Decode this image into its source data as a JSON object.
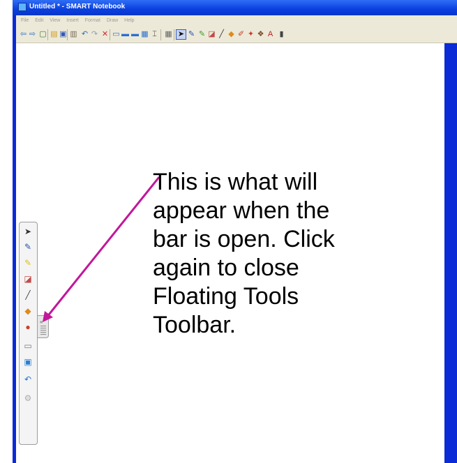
{
  "window": {
    "title": "Untitled * - SMART Notebook"
  },
  "menu": [
    "File",
    "Edit",
    "View",
    "Insert",
    "Format",
    "Draw",
    "Help"
  ],
  "toolbar": {
    "icons": [
      {
        "name": "back-icon",
        "glyph": "⇦",
        "color": "#2a6fd1"
      },
      {
        "name": "forward-icon",
        "glyph": "⇨",
        "color": "#2a6fd1"
      },
      {
        "name": "add-page-icon",
        "glyph": "▢",
        "color": "#3c7a2e"
      },
      {
        "name": "open-icon",
        "glyph": "▤",
        "color": "#d39a1a"
      },
      {
        "name": "save-icon",
        "glyph": "▣",
        "color": "#3059b8"
      },
      {
        "name": "paste-icon",
        "glyph": "▥",
        "color": "#7a6a5a"
      },
      {
        "name": "undo-icon",
        "glyph": "↶",
        "color": "#2a6fd1"
      },
      {
        "name": "redo-icon",
        "glyph": "↷",
        "color": "#8aa0c0"
      },
      {
        "name": "delete-icon",
        "glyph": "✕",
        "color": "#d12a2a"
      },
      {
        "name": "screen-shade-icon",
        "glyph": "▭",
        "color": "#2a6fd1"
      },
      {
        "name": "full-screen-icon",
        "glyph": "▬",
        "color": "#2a6fd1"
      },
      {
        "name": "dual-page-icon",
        "glyph": "▬",
        "color": "#2a6fd1"
      },
      {
        "name": "screen-capture-icon",
        "glyph": "▦",
        "color": "#2a6fd1"
      },
      {
        "name": "document-camera-icon",
        "glyph": "⌶",
        "color": "#333333"
      },
      {
        "name": "table-icon",
        "glyph": "▦",
        "color": "#666666"
      },
      {
        "name": "select-icon",
        "glyph": "➤",
        "color": "#111111"
      },
      {
        "name": "pen-icon",
        "glyph": "✎",
        "color": "#2a4fb0"
      },
      {
        "name": "creative-pen-icon",
        "glyph": "✎",
        "color": "#3d9a2a"
      },
      {
        "name": "eraser-icon",
        "glyph": "◪",
        "color": "#c14a4a"
      },
      {
        "name": "line-icon",
        "glyph": "╱",
        "color": "#333333"
      },
      {
        "name": "shapes-icon",
        "glyph": "◆",
        "color": "#e08a1a"
      },
      {
        "name": "fill-icon",
        "glyph": "✐",
        "color": "#c8402a"
      },
      {
        "name": "magic-pen-icon",
        "glyph": "✦",
        "color": "#c8402a"
      },
      {
        "name": "properties-icon",
        "glyph": "❖",
        "color": "#7a4a2a"
      },
      {
        "name": "text-icon",
        "glyph": "A",
        "color": "#c81a1a"
      },
      {
        "name": "more-icon",
        "glyph": "▮",
        "color": "#444444"
      }
    ]
  },
  "floating_toolbar": {
    "icons": [
      {
        "name": "select-icon",
        "glyph": "➤",
        "color": "#333333"
      },
      {
        "name": "pen-icon",
        "glyph": "✎",
        "color": "#2a4fb0"
      },
      {
        "name": "highlighter-icon",
        "glyph": "✎",
        "color": "#e0c21a"
      },
      {
        "name": "eraser-icon",
        "glyph": "◪",
        "color": "#c14a4a"
      },
      {
        "name": "line-icon",
        "glyph": "╱",
        "color": "#444444"
      },
      {
        "name": "shapes-icon",
        "glyph": "◆",
        "color": "#e08a1a"
      },
      {
        "name": "fill-icon",
        "glyph": "●",
        "color": "#c8402a"
      },
      {
        "name": "keyboard-icon",
        "glyph": "▭",
        "color": "#777777"
      },
      {
        "name": "page-icon",
        "glyph": "▣",
        "color": "#2a7fd1"
      },
      {
        "name": "undo-icon",
        "glyph": "↶",
        "color": "#2a6fd1"
      },
      {
        "name": "customize-icon",
        "glyph": "⚙",
        "color": "#aaaaaa"
      }
    ],
    "collapse_glyph": "«"
  },
  "annotation": {
    "lines": [
      "This is what will",
      "appear when the",
      "bar is open. Click",
      "again to close",
      "Floating Tools",
      "Toolbar."
    ],
    "arrow_color": "#c1179a"
  }
}
